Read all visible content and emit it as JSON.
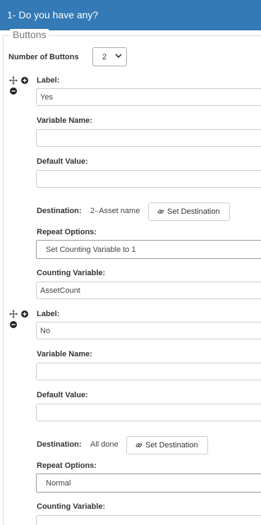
{
  "header": {
    "title": "1- Do you have any?"
  },
  "section": {
    "legend": "Buttons"
  },
  "number_of_buttons": {
    "label": "Number of Buttons",
    "value": "2"
  },
  "buttons": [
    {
      "label_caption": "Label:",
      "label_value": "Yes",
      "variable_caption": "Variable Name:",
      "variable_value": "",
      "default_caption": "Default Value:",
      "default_value": "",
      "destination_caption": "Destination:",
      "destination_value": "2- Asset name",
      "set_destination_label": "Set Destination",
      "repeat_caption": "Repeat Options:",
      "repeat_value": "Set Counting Variable to 1",
      "counting_caption": "Counting Variable:",
      "counting_value": "AssetCount"
    },
    {
      "label_caption": "Label:",
      "label_value": "No",
      "variable_caption": "Variable Name:",
      "variable_value": "",
      "default_caption": "Default Value:",
      "default_value": "",
      "destination_caption": "Destination:",
      "destination_value": "All done",
      "set_destination_label": "Set Destination",
      "repeat_caption": "Repeat Options:",
      "repeat_value": "Normal",
      "counting_caption": "Counting Variable:",
      "counting_value": ""
    }
  ],
  "colors": {
    "header_bg": "#337ab7",
    "header_text": "#ffffff"
  },
  "icons": {
    "move": "move-arrows-icon",
    "add": "plus-circle-icon",
    "remove": "minus-circle-icon",
    "link": "link-icon",
    "chevron": "chevron-down-icon"
  }
}
